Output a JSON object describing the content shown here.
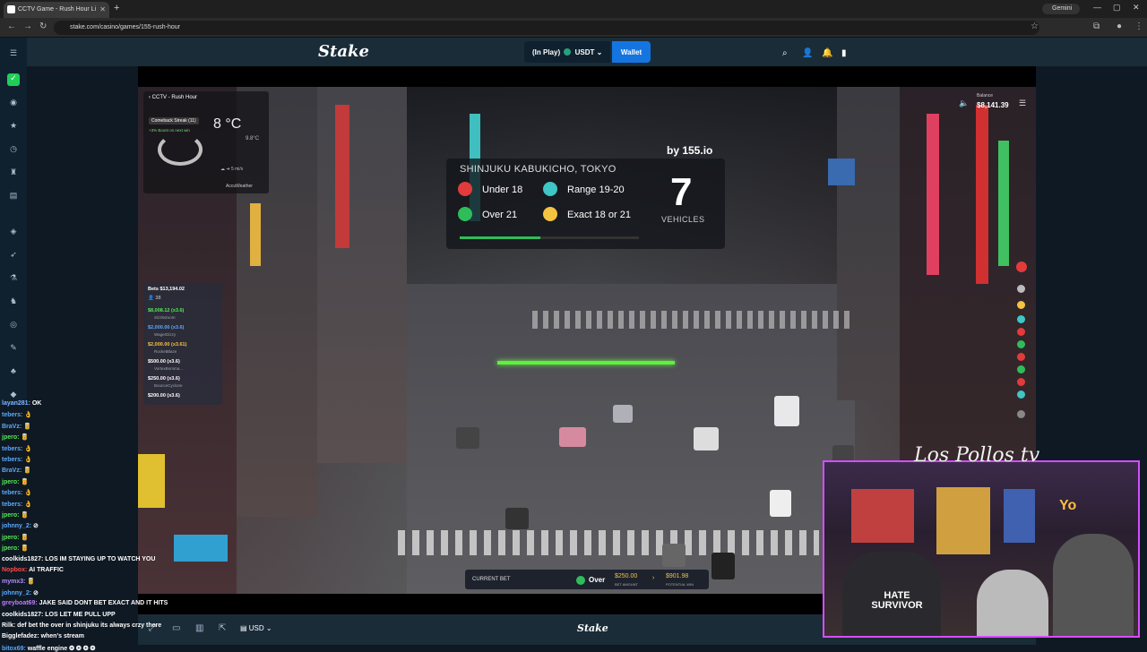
{
  "browser": {
    "tab_title": "CCTV Game - Rush Hour Li",
    "url": "stake.com/casino/games/155-rush-hour",
    "gemini_label": "Gemini"
  },
  "header": {
    "logo": "Stake",
    "play_mode": "(In Play)",
    "currency": "USDT",
    "wallet_label": "Wallet"
  },
  "game": {
    "cctv_title": "CCTV - Rush Hour",
    "comeback_streak": "Comeback Streak (11)",
    "boost_text": "+3% Boost on next win",
    "temperature": "8 °C",
    "temp_small": "9.8°C",
    "wind": "5 mi/s",
    "weather_source": "AccuWeather",
    "location": "SHINJUKU KABUKICHO, TOKYO",
    "byline": "by 155.io",
    "options": {
      "under": "Under 18",
      "range": "Range 19-20",
      "over": "Over 21",
      "exact": "Exact 18 or 21"
    },
    "vehicle_count": "7",
    "vehicles_label": "VEHICLES",
    "progress": 0.45,
    "balance_label": "Balance",
    "balance_value": "$8,141.39",
    "bets_header": "Bets $13,194.02",
    "bets_count": "38",
    "bets": [
      {
        "amount": "$8,008.12 (x3.6)",
        "user": "SizzleZoom",
        "color": "#54e854"
      },
      {
        "amount": "$2,000.00 (x3.6)",
        "user": "WagerDizzy",
        "color": "#5aa9ff"
      },
      {
        "amount": "$2,000.00 (x3.61)",
        "user": "RocketBlaze",
        "color": "#f5c342"
      },
      {
        "amount": "$500.00 (x3.6)",
        "user": "VortexBomma...",
        "color": "#ffffff"
      },
      {
        "amount": "$250.00 (x3.6)",
        "user": "BounceCyclone",
        "color": "#ffffff"
      },
      {
        "amount": "$200.00 (x3.6)",
        "user": "",
        "color": "#ffffff"
      }
    ],
    "current_bet_label": "CURRENT BET",
    "current_bet_pick": "Over",
    "bet_amount": "$250.00",
    "bet_amount_label": "BET AMOUNT",
    "potential_win": "$901.98",
    "potential_win_label": "POTENTIAL WIN"
  },
  "bottom": {
    "currency": "USD",
    "logo": "Stake"
  },
  "webcam": {
    "signature": "Los Pollos tv",
    "shirt_text": "HATE SURVIVOR"
  },
  "chat": [
    {
      "user": "layan281:",
      "msg": "OK",
      "color": "#7fb3ff"
    },
    {
      "user": "tebers:",
      "msg": "👌",
      "color": "#5aa9ff"
    },
    {
      "user": "BraVz:",
      "msg": "🥫",
      "color": "#5aa9ff"
    },
    {
      "user": "jpero:",
      "msg": "🥫",
      "color": "#54e854"
    },
    {
      "user": "tebers:",
      "msg": "👌",
      "color": "#5aa9ff"
    },
    {
      "user": "tebers:",
      "msg": "👌",
      "color": "#5aa9ff"
    },
    {
      "user": "BraVz:",
      "msg": "🥫",
      "color": "#5aa9ff"
    },
    {
      "user": "jpero:",
      "msg": "🥫",
      "color": "#54e854"
    },
    {
      "user": "tebers:",
      "msg": "👌",
      "color": "#5aa9ff"
    },
    {
      "user": "tebers:",
      "msg": "👌",
      "color": "#5aa9ff"
    },
    {
      "user": "jpero:",
      "msg": "🥫",
      "color": "#54e854"
    },
    {
      "user": "johnny_2:",
      "msg": "⊘",
      "color": "#5aa9ff"
    },
    {
      "user": "jpero:",
      "msg": "🥫",
      "color": "#54e854"
    },
    {
      "user": "jpero:",
      "msg": "🥫",
      "color": "#54e854"
    },
    {
      "user": "coolkids1827:",
      "msg": "LOS IM STAYING UP TO WATCH YOU",
      "color": "#ffffff"
    },
    {
      "user": "Nopbox:",
      "msg": "AI TRAFFIC",
      "color": "#ff4a4a"
    },
    {
      "user": "mymx3:",
      "msg": "🥫",
      "color": "#b58cff"
    },
    {
      "user": "johnny_2:",
      "msg": "⊘",
      "color": "#5aa9ff"
    },
    {
      "user": "greyboat69:",
      "msg": "JAKE SAID DONT BET EXACT AND IT HITS",
      "color": "#c07bff"
    },
    {
      "user": "coolkids1827:",
      "msg": "LOS LET ME PULL UPP",
      "color": "#ffffff"
    },
    {
      "user": "Rilk:",
      "msg": "def bet the over in shinjuku its always crzy there",
      "color": "#ffffff"
    },
    {
      "user": "Bigglefadez:",
      "msg": "when's stream",
      "color": "#ffffff"
    },
    {
      "user": "bitox69:",
      "msg": "waffle engine ❂ ❂ ❂ ❂",
      "color": "#5aa9ff"
    }
  ]
}
